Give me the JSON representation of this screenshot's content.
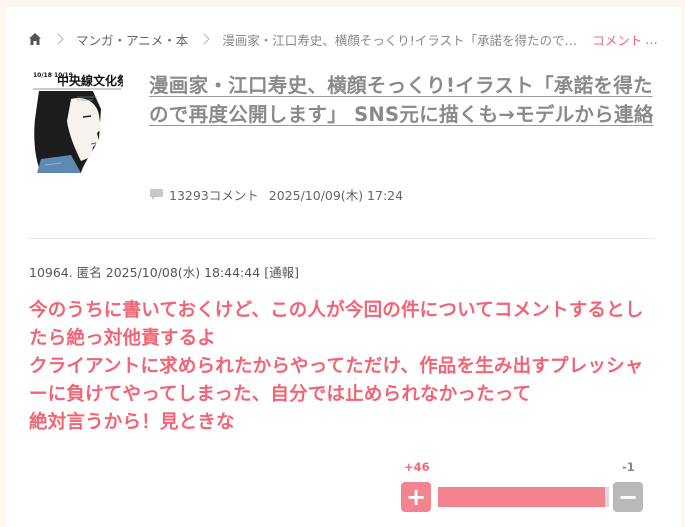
{
  "breadcrumb": {
    "home_icon": "home-icon",
    "category": "マンガ・アニメ・本",
    "current": "漫画家・江口寿史、横顔そっくり!イラスト「承諾を得たので再度公開します」",
    "comment_link": "コメント",
    "more": "…"
  },
  "article": {
    "title": "漫画家・江口寿史、横顔そっくり!イラスト「承諾を得たので再度公開します」 SNS元に描くも→モデルから連絡",
    "comment_count": "13293コメント",
    "date": "2025/10/09(木) 17:24",
    "thumbnail": {
      "poster_text": "中央線文化祭",
      "date_text": "10/18 10/19"
    }
  },
  "comment": {
    "number": "10964.",
    "name": "匿名",
    "datetime": "2025/10/08(水) 18:44:44",
    "report": "[通報]",
    "body": "今のうちに書いておくけど、この人が今回の件についてコメントするとしたら絶っ対他責するよ\nクライアントに求められたからやってただけ、作品を生み出すプレッシャーに負けてやってしまった、自分では止められなかったって\n絶対言うから！見ときな"
  },
  "vote": {
    "plus_label": "+",
    "minus_label": "−",
    "plus_count": "+46",
    "minus_count": "-1",
    "plus_ratio": 0.979
  },
  "colors": {
    "accent": "#f06474",
    "title_gray": "#8a8a8a",
    "background": "#fbf7ef",
    "bar_pink": "#f3838e",
    "bar_gray": "#b9b9b9"
  }
}
